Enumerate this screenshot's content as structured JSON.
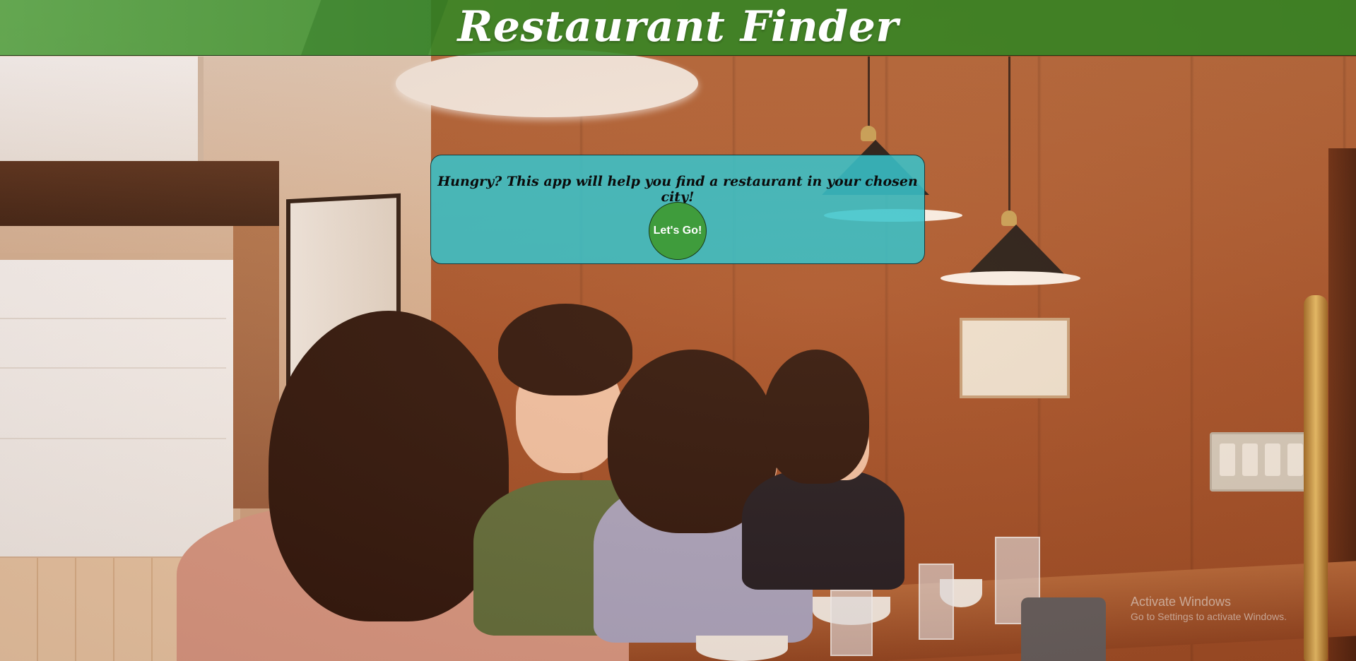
{
  "header": {
    "title": "Restaurant Finder"
  },
  "intro": {
    "text": "Hungry? This app will help you find a restaurant in your chosen city!",
    "button_label": "Let's Go!"
  },
  "watermark": {
    "title": "Activate Windows",
    "subtitle": "Go to Settings to activate Windows."
  },
  "colors": {
    "header_bg": "#348726",
    "card_bg": "#38c4cc",
    "button_bg": "#3f9c3c"
  }
}
